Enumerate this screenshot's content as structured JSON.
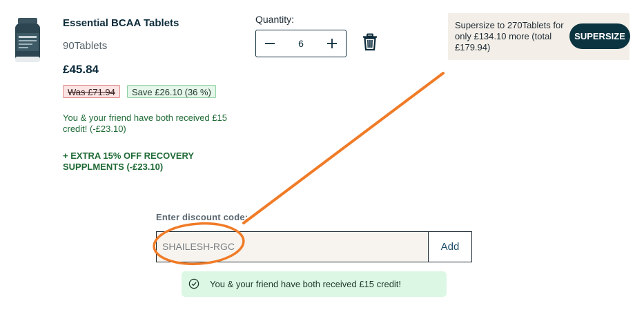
{
  "product": {
    "title": "Essential BCAA Tablets",
    "variant": "90Tablets",
    "price": "£45.84",
    "was_price": "Was £71.94",
    "save_label": "Save £26.10 (36 %)",
    "promo_friend": "You & your friend have both received £15 credit! (-£23.10)",
    "promo_recovery": "+ EXTRA 15% OFF RECOVERY SUPPLMENTS (-£23.10)",
    "image_icon": "supplement-bottle",
    "image_label": "ESSENTIAL BCAA"
  },
  "quantity": {
    "label": "Quantity:",
    "value": "6",
    "minus_icon": "minus-icon",
    "plus_icon": "plus-icon"
  },
  "remove": {
    "icon": "trash-icon"
  },
  "upsell": {
    "text": "Supersize to 270Tablets for only £134.10 more (total £179.94)",
    "button_label": "SUPERSIZE"
  },
  "discount": {
    "label": "Enter discount code:",
    "value": "SHAILESH-RGC",
    "add_label": "Add"
  },
  "success": {
    "icon": "check-circle-icon",
    "message": "You & your friend have both received £15 credit!"
  },
  "colors": {
    "brand_dark": "#0c3440",
    "success_bg": "#dcf7e4",
    "annotation": "#f07b27"
  }
}
